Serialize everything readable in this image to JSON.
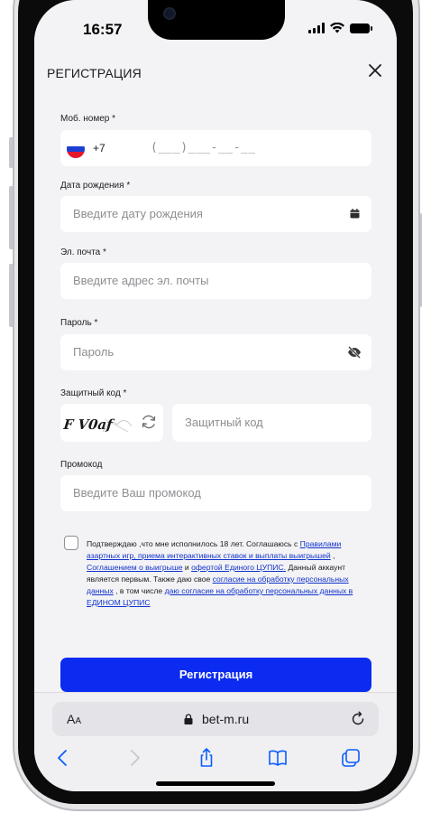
{
  "status_bar": {
    "time": "16:57"
  },
  "header": {
    "title": "РЕГИСТРАЦИЯ"
  },
  "form": {
    "phone": {
      "label": "Моб. номер *",
      "country_code": "+7",
      "mask": "(___)___-__-__"
    },
    "birth_date": {
      "label": "Дата рождения *",
      "placeholder": "Введите дату рождения"
    },
    "email": {
      "label": "Эл. почта *",
      "placeholder": "Введите адрес эл. почты"
    },
    "password": {
      "label": "Пароль *",
      "placeholder": "Пароль"
    },
    "captcha": {
      "label": "Защитный код *",
      "image_text": "F V0af",
      "placeholder": "Защитный код"
    },
    "promo": {
      "label": "Промокод",
      "placeholder": "Введите Ваш промокод"
    }
  },
  "consent": {
    "checked": false,
    "text_1": "Подтверждаю ,что мне исполнилось 18 лет. Соглашаюсь с ",
    "link_rules": "Правилами азартных игр, приема интерактивных ставок и выплаты выигрышей",
    "text_2": " , ",
    "link_agreement": "Соглашением о выигрыше",
    "text_3": "  и ",
    "link_offer": "офертой Единого ЦУПИС.",
    "text_4": " Данный аккаунт является первым. Также даю свое ",
    "link_pd": "согласие на обработку персональных данных",
    "text_5": " , в том числе ",
    "link_pd_cupis": "даю согласие на обработку персональных данных в ЕДИНОМ ЦУПИС"
  },
  "submit_label": "Регистрация",
  "safari": {
    "aa_big": "A",
    "aa_small": "A",
    "url": "bet-m.ru"
  },
  "colors": {
    "accent": "#0c2bf0",
    "link": "#1133cc",
    "background": "#f3f3f5"
  }
}
